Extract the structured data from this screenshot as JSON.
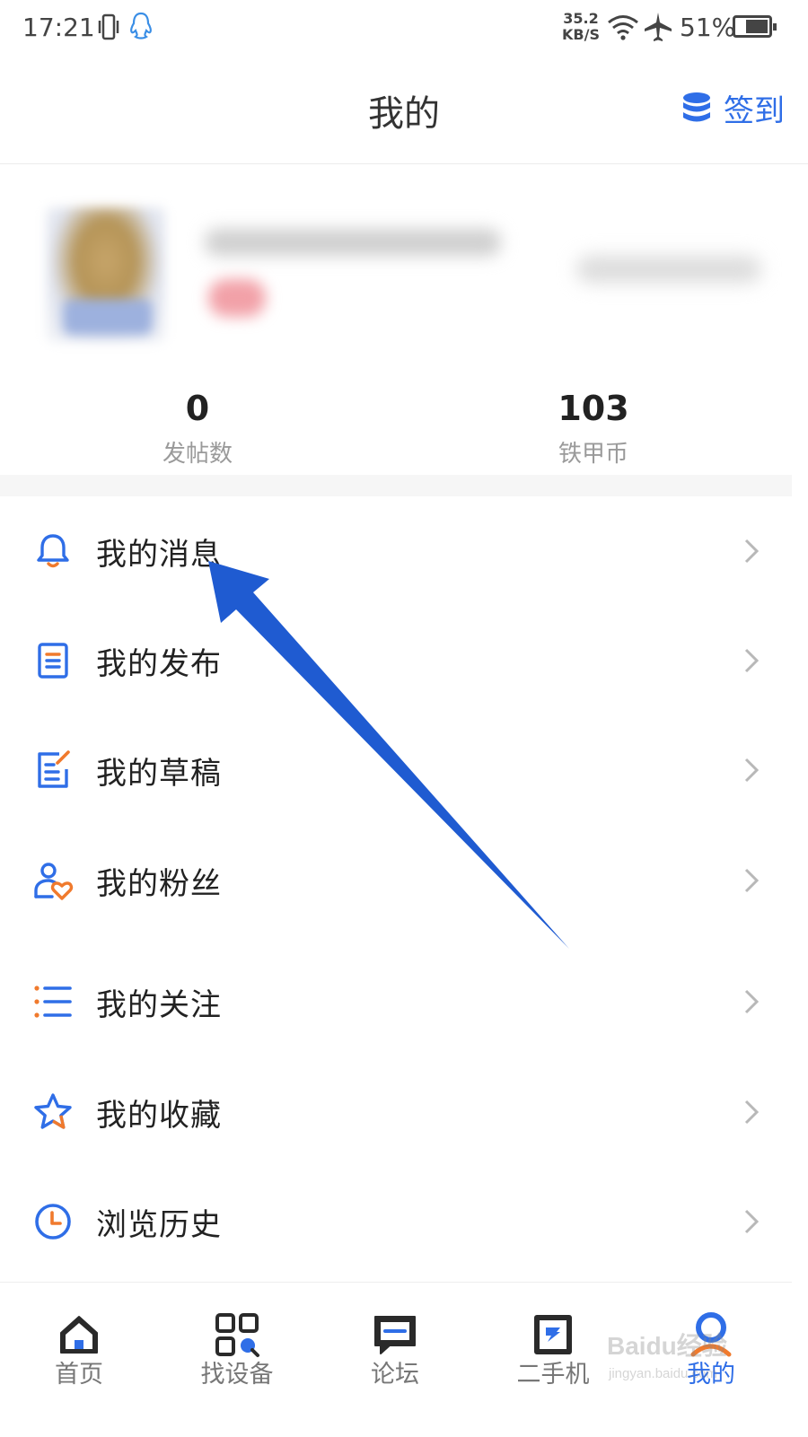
{
  "status_bar": {
    "time": "17:21",
    "speed_value": "35.2",
    "speed_unit": "KB/S",
    "battery": "51%"
  },
  "header": {
    "title": "我的",
    "signin_label": "签到"
  },
  "stats": [
    {
      "value": "0",
      "label": "发帖数"
    },
    {
      "value": "103",
      "label": "铁甲币"
    }
  ],
  "menu": [
    {
      "label": "我的消息",
      "icon": "bell-icon"
    },
    {
      "label": "我的发布",
      "icon": "document-icon"
    },
    {
      "label": "我的草稿",
      "icon": "draft-edit-icon"
    },
    {
      "label": "我的粉丝",
      "icon": "fans-icon"
    },
    {
      "label": "我的关注",
      "icon": "list-icon"
    },
    {
      "label": "我的收藏",
      "icon": "star-icon"
    },
    {
      "label": "浏览历史",
      "icon": "clock-icon"
    }
  ],
  "tabs": [
    {
      "label": "首页",
      "icon": "home-icon"
    },
    {
      "label": "找设备",
      "icon": "find-device-icon"
    },
    {
      "label": "论坛",
      "icon": "forum-icon"
    },
    {
      "label": "二手机",
      "icon": "used-machine-icon"
    },
    {
      "label": "我的",
      "icon": "profile-icon",
      "active": true
    }
  ],
  "watermark": {
    "main": "Baidu经验",
    "sub": "jingyan.baidu.com"
  },
  "colors": {
    "accent": "#2f6ee7",
    "icon_orange": "#f07a2d",
    "annotation_arrow": "#1f5bd1"
  }
}
